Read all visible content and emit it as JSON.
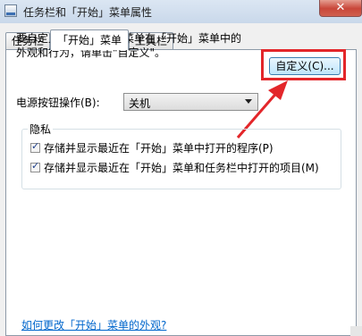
{
  "window": {
    "title": "任务栏和「开始」菜单属性",
    "close_glyph": "✕"
  },
  "tabs": [
    {
      "label": "任务栏",
      "active": false
    },
    {
      "label": "「开始」菜单",
      "active": true
    },
    {
      "label": "工具栏",
      "active": false
    }
  ],
  "start_menu": {
    "description_lines": [
      "要自定义链接、图标和菜单在「开始」菜单中的",
      "外观和行为，请单击\"自定义\"。"
    ],
    "customize_button": "自定义(C)...",
    "power_button_label": "电源按钮操作(B):",
    "power_button_value": "关机",
    "privacy": {
      "title": "隐私",
      "options": [
        {
          "label": "存储并显示最近在「开始」菜单中打开的程序(P)",
          "checked": true
        },
        {
          "label": "存储并显示最近在「开始」菜单和任务栏中打开的项目(M)",
          "checked": true
        }
      ]
    },
    "help_link": "如何更改「开始」菜单的外观?"
  },
  "annotation": {
    "highlight_color": "#e3262a"
  }
}
